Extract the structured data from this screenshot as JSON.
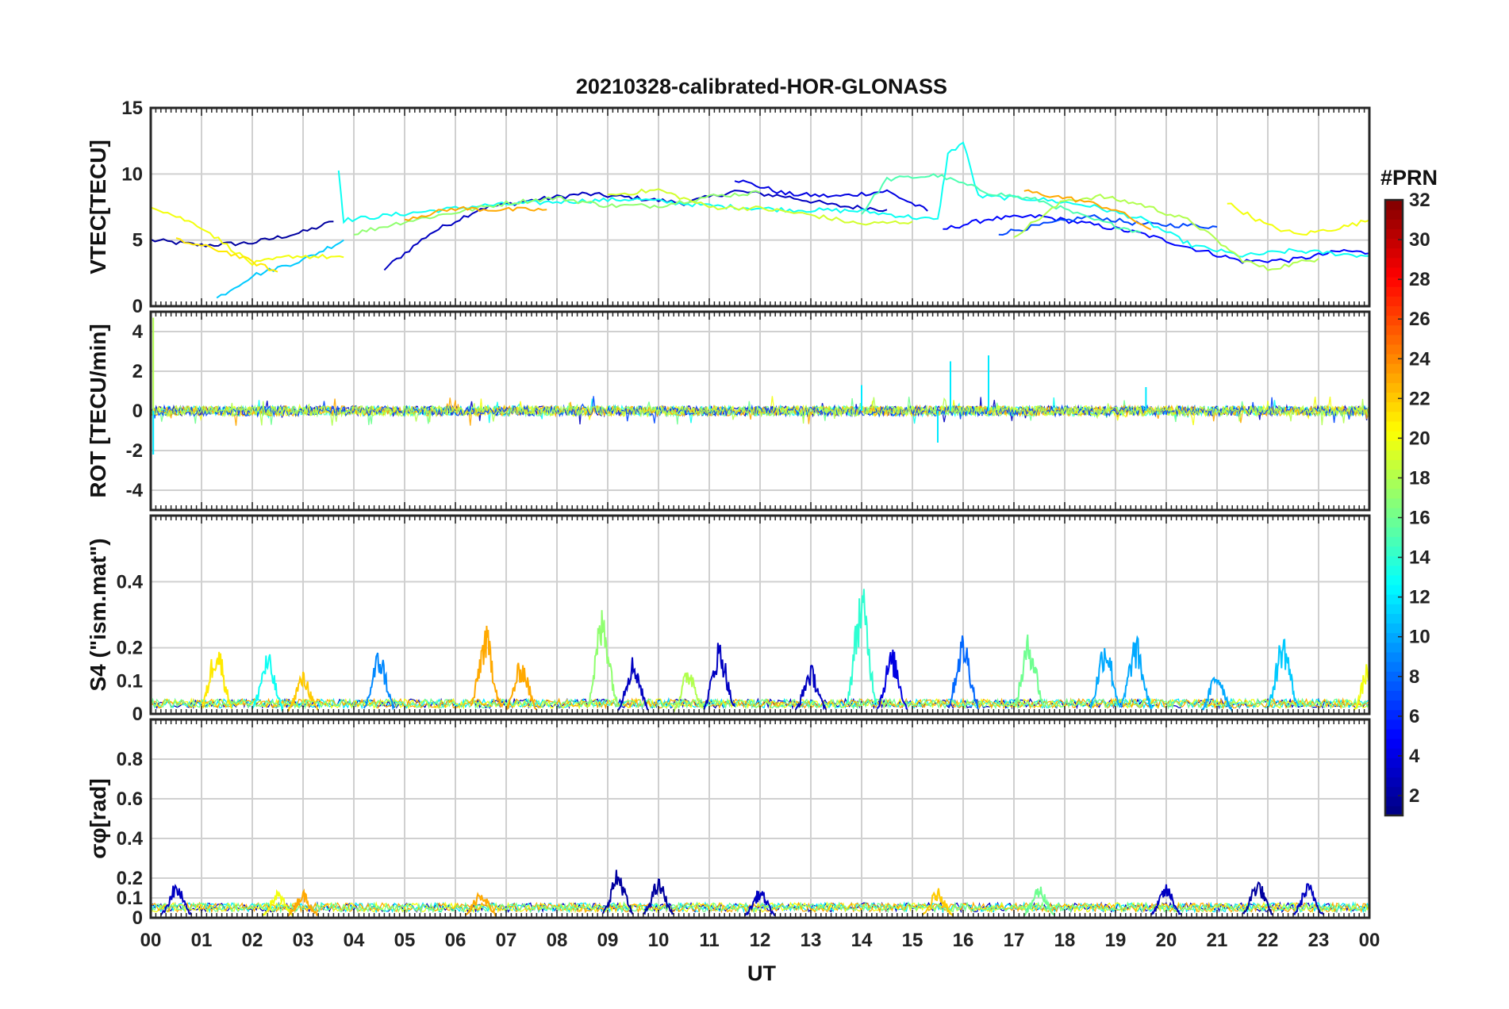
{
  "chart_data": {
    "type": "line",
    "title": "20210328-calibrated-HOR-GLONASS",
    "xlabel": "UT",
    "x_ticks": [
      "00",
      "01",
      "02",
      "03",
      "04",
      "05",
      "06",
      "07",
      "08",
      "09",
      "10",
      "11",
      "12",
      "13",
      "14",
      "15",
      "16",
      "17",
      "18",
      "19",
      "20",
      "21",
      "22",
      "23",
      "00"
    ],
    "xlim": [
      0,
      24
    ],
    "grid": true,
    "colorbar": {
      "label": "#PRN",
      "colormap": "jet",
      "range": [
        1,
        32
      ],
      "ticks": [
        2,
        4,
        6,
        8,
        10,
        12,
        14,
        16,
        18,
        20,
        22,
        24,
        26,
        28,
        30,
        32
      ],
      "tick_labels": [
        "2",
        "4",
        "6",
        "8",
        "10",
        "12",
        "14",
        "16",
        "18",
        "20",
        "22",
        "24",
        "26",
        "28",
        "30",
        "32"
      ]
    },
    "panels": [
      {
        "ylabel": "VTEC[TECU]",
        "ylim": [
          0,
          15
        ],
        "y_ticks": [
          "0",
          "5",
          "10",
          "15"
        ],
        "y_tick_values": [
          0,
          5,
          10,
          15
        ],
        "series": [
          {
            "prn": 2,
            "points": [
              [
                0,
                5
              ],
              [
                1,
                4.6
              ],
              [
                2,
                4.8
              ],
              [
                3,
                5.6
              ],
              [
                3.6,
                6.4
              ]
            ]
          },
          {
            "prn": 3,
            "points": [
              [
                4.6,
                2.8
              ],
              [
                5.5,
                5.5
              ],
              [
                6.5,
                7.4
              ],
              [
                7.5,
                8
              ],
              [
                8.5,
                8.5
              ],
              [
                9.5,
                8.2
              ],
              [
                10.5,
                7.8
              ],
              [
                11.5,
                8.7
              ],
              [
                12.5,
                8.3
              ],
              [
                13.5,
                7.6
              ],
              [
                14.5,
                7.3
              ]
            ]
          },
          {
            "prn": 4,
            "points": [
              [
                11.5,
                9.6
              ],
              [
                12.5,
                8.5
              ],
              [
                13.5,
                8.3
              ],
              [
                14.5,
                8.7
              ],
              [
                15.3,
                7.2
              ]
            ]
          },
          {
            "prn": 5,
            "points": [
              [
                15.6,
                5.8
              ],
              [
                16.5,
                6.6
              ],
              [
                17.5,
                6.8
              ],
              [
                18.5,
                6.2
              ],
              [
                19.5,
                5.5
              ],
              [
                20.5,
                4.4
              ],
              [
                21.5,
                3.4
              ],
              [
                22.5,
                3.5
              ],
              [
                23.5,
                4.2
              ],
              [
                24,
                4
              ]
            ]
          },
          {
            "prn": 7,
            "points": [
              [
                16.7,
                5.5
              ],
              [
                17.5,
                6.1
              ],
              [
                18.5,
                6.8
              ],
              [
                19.5,
                6.2
              ],
              [
                20.5,
                6.1
              ],
              [
                21,
                6
              ]
            ]
          },
          {
            "prn": 11,
            "points": [
              [
                1.3,
                0.6
              ],
              [
                2,
                2.3
              ],
              [
                3,
                3.5
              ],
              [
                3.8,
                5
              ]
            ]
          },
          {
            "prn": 13,
            "points": [
              [
                3.7,
                10.3
              ],
              [
                3.8,
                6.5
              ],
              [
                5,
                7
              ],
              [
                6.5,
                7.6
              ],
              [
                8,
                7.9
              ],
              [
                9.5,
                8.1
              ],
              [
                11,
                7.6
              ],
              [
                12.5,
                7.3
              ],
              [
                14,
                7.2
              ],
              [
                15.5,
                6.5
              ],
              [
                15.7,
                11.5
              ],
              [
                16,
                12.4
              ],
              [
                16.3,
                8.3
              ],
              [
                17.5,
                8.1
              ],
              [
                18.5,
                7.6
              ],
              [
                19.5,
                6.6
              ],
              [
                20.5,
                4.6
              ],
              [
                21.5,
                3.8
              ],
              [
                22.5,
                4.2
              ],
              [
                24,
                3.8
              ]
            ]
          },
          {
            "prn": 15,
            "points": [
              [
                14,
                7
              ],
              [
                14.5,
                9.6
              ],
              [
                15.5,
                9.9
              ],
              [
                16.5,
                8.6
              ],
              [
                17.5,
                8
              ],
              [
                18.5,
                6.6
              ],
              [
                19.5,
                5.6
              ]
            ]
          },
          {
            "prn": 17,
            "points": [
              [
                4,
                5.5
              ],
              [
                5,
                6.4
              ],
              [
                6,
                7.1
              ],
              [
                7,
                7.8
              ],
              [
                8,
                8.2
              ],
              [
                9,
                7.6
              ],
              [
                10,
                7.6
              ],
              [
                11,
                8.3
              ],
              [
                12,
                8.6
              ]
            ]
          },
          {
            "prn": 18,
            "points": [
              [
                17,
                5.3
              ],
              [
                18,
                8
              ],
              [
                18.7,
                8.3
              ],
              [
                19.5,
                7.7
              ],
              [
                20.5,
                6.4
              ],
              [
                21.5,
                3.5
              ],
              [
                22,
                2.8
              ],
              [
                23,
                3.6
              ]
            ]
          },
          {
            "prn": 20,
            "points": [
              [
                0,
                7.6
              ],
              [
                1,
                6
              ],
              [
                2,
                3.2
              ],
              [
                2.8,
                3.8
              ],
              [
                3.8,
                3.7
              ]
            ]
          },
          {
            "prn": 21,
            "points": [
              [
                0.5,
                5
              ],
              [
                1.5,
                4.1
              ],
              [
                2.5,
                2.6
              ]
            ]
          },
          {
            "prn": 19,
            "points": [
              [
                9,
                8.4
              ],
              [
                10,
                8.8
              ],
              [
                11,
                7.5
              ],
              [
                12,
                7.4
              ],
              [
                13,
                6.9
              ],
              [
                14,
                6.2
              ],
              [
                15,
                6.4
              ]
            ]
          },
          {
            "prn": 20,
            "points": [
              [
                21.2,
                7.8
              ],
              [
                22,
                6.1
              ],
              [
                22.6,
                5.4
              ],
              [
                23.5,
                6
              ],
              [
                24,
                6.5
              ]
            ]
          },
          {
            "prn": 23,
            "points": [
              [
                5,
                6.6
              ],
              [
                6,
                7.4
              ],
              [
                6.8,
                7.3
              ],
              [
                7.8,
                7.3
              ]
            ]
          },
          {
            "prn": 23,
            "points": [
              [
                17.2,
                8.7
              ],
              [
                18.3,
                8
              ],
              [
                19,
                7.3
              ],
              [
                19.7,
                5.8
              ]
            ]
          }
        ]
      },
      {
        "ylabel": "ROT [TECU/min]",
        "ylim": [
          -5,
          5
        ],
        "y_ticks": [
          "-4",
          "-2",
          "0",
          "2",
          "4"
        ],
        "y_tick_values": [
          -4,
          -2,
          0,
          2,
          4
        ],
        "noise_level": 0.25,
        "spikes": [
          [
            0.05,
            4.7
          ],
          [
            0.05,
            -2.2
          ],
          [
            15.75,
            2.5
          ],
          [
            16.5,
            2.8
          ],
          [
            15.5,
            -1.6
          ],
          [
            19.6,
            1.2
          ],
          [
            14.0,
            1.3
          ]
        ]
      },
      {
        "ylabel": "S4 (\"ism.mat\")",
        "ylim": [
          0,
          0.6
        ],
        "y_ticks": [
          "0",
          "0.1",
          "0.2",
          "0.4"
        ],
        "y_tick_values": [
          0,
          0.1,
          0.2,
          0.4
        ],
        "bursts": [
          [
            1.3,
            0.23,
            21
          ],
          [
            2.3,
            0.19,
            13
          ],
          [
            3.0,
            0.13,
            22
          ],
          [
            4.5,
            0.2,
            9
          ],
          [
            6.6,
            0.27,
            23
          ],
          [
            7.3,
            0.17,
            23
          ],
          [
            8.9,
            0.33,
            17
          ],
          [
            9.5,
            0.18,
            3
          ],
          [
            10.6,
            0.15,
            18
          ],
          [
            11.2,
            0.23,
            3
          ],
          [
            13.0,
            0.15,
            3
          ],
          [
            14.0,
            0.4,
            14
          ],
          [
            14.6,
            0.2,
            4
          ],
          [
            16.0,
            0.25,
            8
          ],
          [
            17.3,
            0.25,
            16
          ],
          [
            18.8,
            0.24,
            10
          ],
          [
            19.4,
            0.24,
            10
          ],
          [
            21.0,
            0.14,
            10
          ],
          [
            22.3,
            0.25,
            11
          ],
          [
            24.0,
            0.17,
            20
          ]
        ]
      },
      {
        "ylabel": "σφ[rad]",
        "ylim": [
          0,
          1
        ],
        "y_ticks": [
          "0",
          "0.1",
          "0.2",
          "0.4",
          "0.6",
          "0.8"
        ],
        "y_tick_values": [
          0,
          0.1,
          0.2,
          0.4,
          0.6,
          0.8
        ],
        "bursts": [
          [
            0.5,
            0.18,
            3
          ],
          [
            2.5,
            0.14,
            20
          ],
          [
            3.0,
            0.14,
            23
          ],
          [
            6.5,
            0.15,
            23
          ],
          [
            9.2,
            0.25,
            2
          ],
          [
            10.0,
            0.2,
            2
          ],
          [
            12.0,
            0.15,
            3
          ],
          [
            15.5,
            0.15,
            22
          ],
          [
            17.5,
            0.17,
            16
          ],
          [
            20.0,
            0.17,
            3
          ],
          [
            21.8,
            0.2,
            2
          ],
          [
            22.8,
            0.18,
            3
          ]
        ]
      }
    ]
  }
}
